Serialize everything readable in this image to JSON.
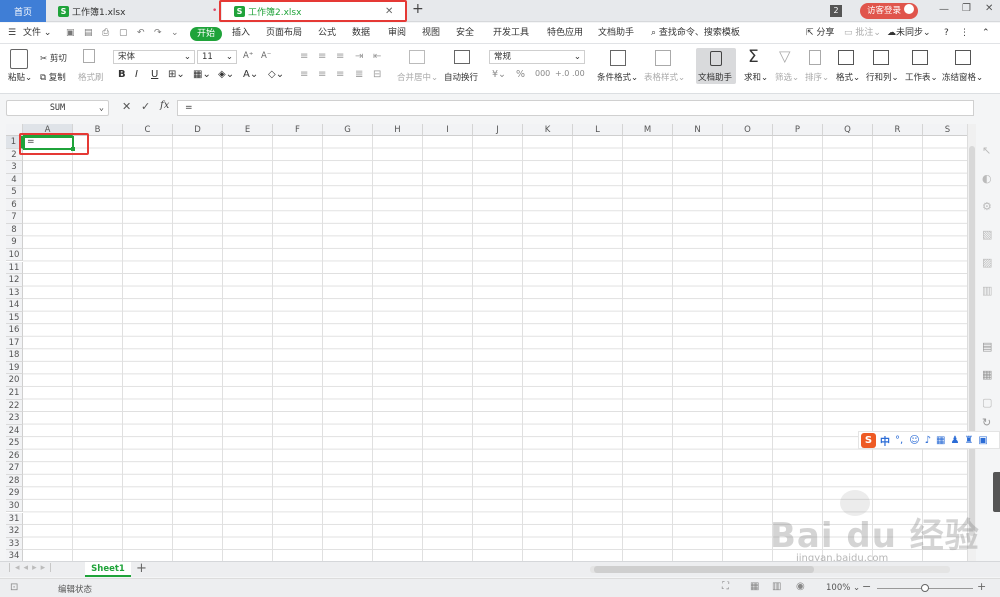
{
  "tabs": {
    "home": "首页",
    "book1": "工作簿1.xlsx",
    "book2": "工作簿2.xlsx",
    "badge": "2",
    "login": "访客登录"
  },
  "menu": {
    "file": "文件",
    "items": [
      "开始",
      "插入",
      "页面布局",
      "公式",
      "数据",
      "审阅",
      "视图",
      "安全",
      "开发工具",
      "特色应用",
      "文档助手"
    ],
    "search": "查找命令、搜索模板",
    "share": "分享",
    "comment": "批注",
    "sync": "未同步"
  },
  "ribbon": {
    "paste": "粘贴",
    "cut": "剪切",
    "copy": "复制",
    "format_painter": "格式刷",
    "font_name": "宋体",
    "font_size": "11",
    "merge_center": "合并居中",
    "auto_wrap": "自动换行",
    "number_format": "常规",
    "conditional_format": "条件格式",
    "table_style": "表格样式",
    "doc_assistant": "文档助手",
    "sum": "求和",
    "filter": "筛选",
    "sort": "排序",
    "format": "格式",
    "row_col": "行和列",
    "worksheet": "工作表",
    "freeze": "冻结窗格"
  },
  "formula_bar": {
    "name_box": "SUM",
    "fx": "fx",
    "content": "="
  },
  "grid": {
    "columns": [
      "A",
      "B",
      "C",
      "D",
      "E",
      "F",
      "G",
      "H",
      "I",
      "J",
      "K",
      "L",
      "M",
      "N",
      "O",
      "P",
      "Q",
      "R",
      "S"
    ],
    "rows": [
      "1",
      "2",
      "3",
      "4",
      "5",
      "6",
      "7",
      "8",
      "9",
      "10",
      "11",
      "12",
      "13",
      "14",
      "15",
      "16",
      "17",
      "18",
      "19",
      "20",
      "21",
      "22",
      "23",
      "24",
      "25",
      "26",
      "27",
      "28",
      "29",
      "30",
      "31",
      "32",
      "33",
      "34"
    ],
    "active_cell_value": "="
  },
  "sheets": {
    "active": "Sheet1"
  },
  "status": {
    "mode": "编辑状态",
    "zoom": "100%"
  },
  "ime": {
    "mode": "中"
  },
  "watermark": {
    "brand": "Bai du 经验",
    "url": "jingyan.baidu.com"
  },
  "colors": {
    "accent_green": "#1fa33a",
    "highlight_red": "#e53935",
    "login_red": "#e0554c"
  }
}
